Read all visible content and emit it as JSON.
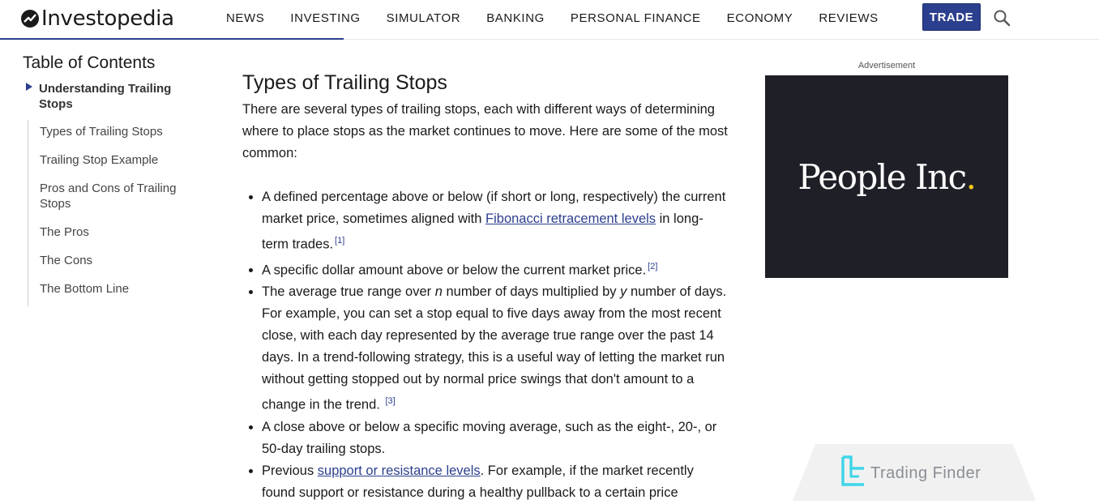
{
  "header": {
    "logo_text": "Investopedia",
    "nav": [
      "NEWS",
      "INVESTING",
      "SIMULATOR",
      "BANKING",
      "PERSONAL FINANCE",
      "ECONOMY",
      "REVIEWS"
    ],
    "trade_label": "TRADE",
    "accent_color": "#2c3f8e"
  },
  "toc": {
    "title": "Table of Contents",
    "current": "Understanding Trailing Stops",
    "items": [
      "Types of Trailing Stops",
      "Trailing Stop Example",
      "Pros and Cons of Trailing Stops",
      "The Pros",
      "The Cons",
      "The Bottom Line"
    ]
  },
  "article": {
    "heading": "Types of Trailing Stops",
    "intro": "There are several types of trailing stops, each with different ways of determining where to place stops as the market continues to move. Here are some of the most common:",
    "b1_pre": "A defined percentage above or below (if short or long, respectively) the current market price, sometimes aligned with ",
    "b1_link": "Fibonacci retracement levels",
    "b1_post": " in long-term trades.",
    "b1_ref": "[1]",
    "b2_text": "A specific dollar amount above or below the current market price.",
    "b2_ref": "[2]",
    "b3_pre": "The average true range over ",
    "b3_n": "n",
    "b3_mid": " number of days multiplied by ",
    "b3_y": "y",
    "b3_post": " number of days. For example, you can set a stop equal to five days away from the most recent close, with each day represented by the average true range over the past 14 days. In a trend-following strategy, this is a useful way of letting the market run without getting stopped out by normal price swings that don't amount to a change in the trend. ",
    "b3_ref": "[3]",
    "b4_text": "A close above or below a specific moving average, such as the eight-, 20-, or 50-day trailing stops.",
    "b5_pre": "Previous ",
    "b5_link": "support or resistance levels",
    "b5_post": ". For example, if the market recently found support or resistance during a healthy pullback to a certain price"
  },
  "ad": {
    "label": "Advertisement",
    "brand": "People Inc",
    "brand_dot": ".",
    "dot_color": "#f5c518"
  },
  "watermark": {
    "text": "Trading Finder"
  }
}
